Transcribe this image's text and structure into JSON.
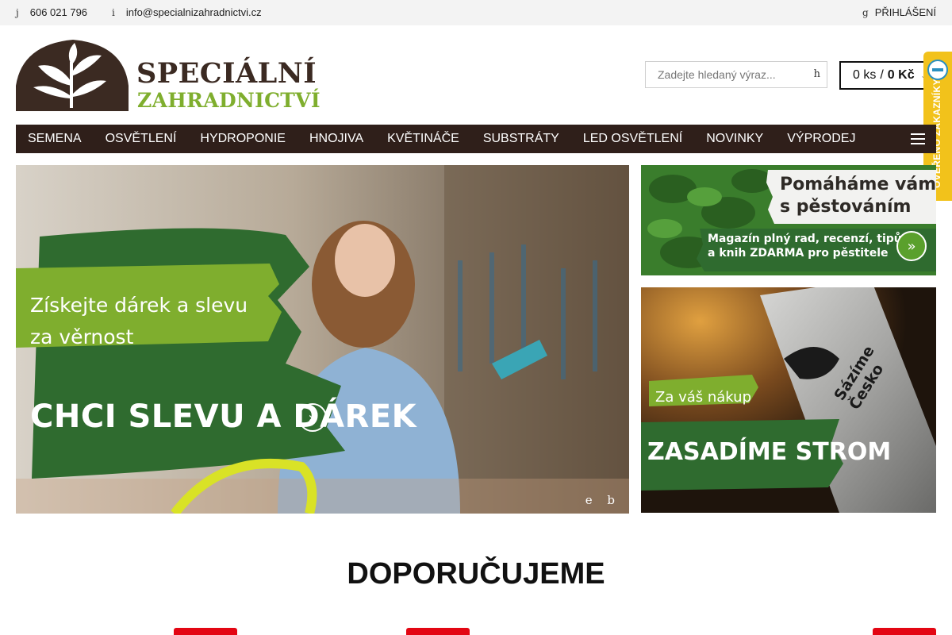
{
  "topbar": {
    "phone_glyph": "j",
    "phone": "606 021 796",
    "mail_glyph": "i",
    "email": "info@specialnizahradnictvi.cz",
    "login_glyph": "g",
    "login": "PŘIHLÁŠENÍ"
  },
  "logo": {
    "line1": "SPECIÁLNÍ",
    "line2": "ZAHRADNICTVÍ",
    "colors": {
      "brown": "#3b2a22",
      "green": "#7fae2e"
    }
  },
  "search": {
    "placeholder": "Zadejte hledaný výraz...",
    "button_glyph": "h"
  },
  "cart": {
    "count": "0 ks",
    "separator": "/",
    "total": "0 Kč",
    "caret": "⌄"
  },
  "badge": {
    "text": "OVĚŘENO ZÁKAZNÍKY",
    "color": "#f2c21b"
  },
  "nav": {
    "items": [
      "SEMENA",
      "OSVĚTLENÍ",
      "HYDROPONIE",
      "HNOJIVA",
      "KVĚTINÁČE",
      "SUBSTRÁTY",
      "LED OSVĚTLENÍ",
      "NOVINKY",
      "VÝPRODEJ"
    ],
    "background": "#2f1f1a"
  },
  "hero": {
    "line1": "Získejte dárek a slevu",
    "line2": "za věrnost",
    "cta": "CHCI SLEVU A DÁREK",
    "cta_icon": "»",
    "prev_glyph": "e",
    "next_glyph": "b",
    "accent_green": "#2f6b2f"
  },
  "banner_magazine": {
    "title_line1": "Pomáháme vám",
    "title_line2": "s pěstováním",
    "sub_line1": "Magazín plný rad, recenzí, tipů",
    "sub_line2": "a knih ZDARMA pro pěstitele",
    "icon": "»"
  },
  "banner_tree": {
    "line1": "Za váš nákup",
    "line2": "ZASADÍME STROM",
    "can_line1": "Sázíme",
    "can_line2": "Česko"
  },
  "section": {
    "title": "DOPORUČUJEME"
  }
}
